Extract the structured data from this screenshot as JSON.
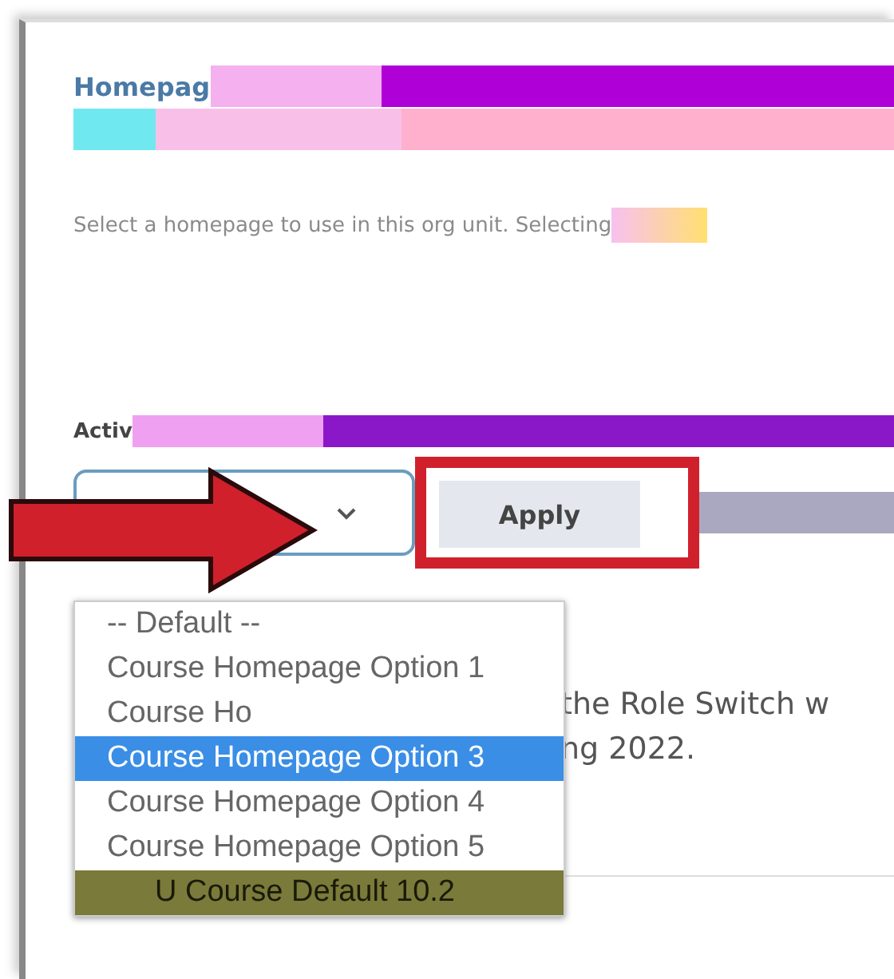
{
  "section": {
    "title": "Homepag",
    "description": "Select a homepage to use in this org unit. Selecting"
  },
  "active_field": {
    "label": "Activ",
    "button": "Apply"
  },
  "dropdown": {
    "options": [
      {
        "label": "-- Default --",
        "selected": false
      },
      {
        "label": "Course Homepage Option 1",
        "selected": false
      },
      {
        "label": "Course Ho",
        "selected": false
      },
      {
        "label": "Course Homepage Option 3",
        "selected": true
      },
      {
        "label": "Course Homepage Option 4",
        "selected": false
      },
      {
        "label": "Course Homepage Option 5",
        "selected": false
      },
      {
        "label": "U Course Default 10.2",
        "selected": false
      }
    ]
  },
  "background_text": [
    "the Role Switch w",
    "ng 2022."
  ]
}
